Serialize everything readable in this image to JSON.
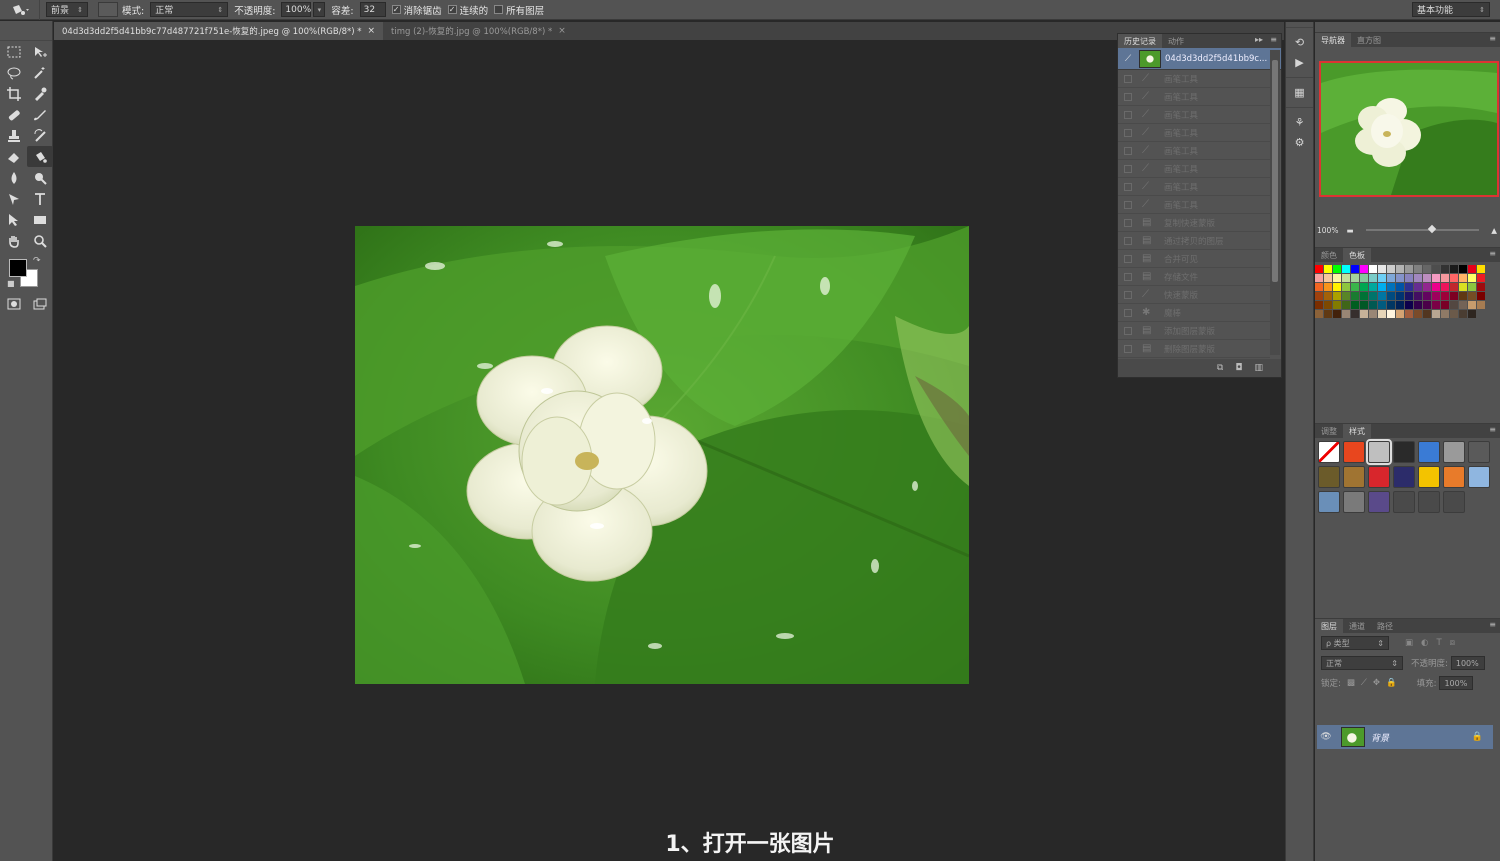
{
  "options_bar": {
    "tool_icon": "paint-bucket-icon",
    "fill_source": "前景",
    "mode_label": "模式:",
    "mode_value": "正常",
    "opacity_label": "不透明度:",
    "opacity_value": "100%",
    "tolerance_label": "容差:",
    "tolerance_value": "32",
    "antialias_label": "消除锯齿",
    "contiguous_label": "连续的",
    "all_layers_label": "所有图层",
    "workspace": "基本功能"
  },
  "tabs": [
    {
      "label": "04d3d3dd2f5d41bb9c77d487721f751e-恢复的.jpeg @ 100%(RGB/8*) *",
      "close": "×"
    },
    {
      "label": "timg (2)-恢复的.jpg @ 100%(RGB/8*) *",
      "close": "×"
    }
  ],
  "history": {
    "tab_history": "历史记录",
    "tab_actions": "动作",
    "snapshot_label": "04d3d3dd2f5d41bb9c...",
    "menu": "▸▸",
    "menu2": "≡"
  },
  "navigator": {
    "tab_navigator": "导航器",
    "tab_histogram": "直方图",
    "zoom": "100%"
  },
  "swatches": {
    "tab_color": "颜色",
    "tab_swatches": "色板",
    "colors": [
      "#ff0000",
      "#ffff00",
      "#00ff00",
      "#00ffff",
      "#0000ff",
      "#ff00ff",
      "#ffffff",
      "#e6e6e6",
      "#cccccc",
      "#b3b3b3",
      "#999999",
      "#808080",
      "#666666",
      "#4d4d4d",
      "#333333",
      "#1a1a1a",
      "#000000",
      "#e6001a",
      "#ffde00",
      "#f5a3a3",
      "#f7c79d",
      "#fdf6a3",
      "#c4df9b",
      "#a3d39c",
      "#82ca9c",
      "#7accc8",
      "#6dcff6",
      "#7ea7d8",
      "#8493ca",
      "#8882be",
      "#a187be",
      "#bc8dbf",
      "#f49ac2",
      "#f6989d",
      "#ff6666",
      "#ffb366",
      "#ffff66",
      "#ed1c24",
      "#f26522",
      "#f7941d",
      "#fff200",
      "#8dc63f",
      "#39b54a",
      "#00a651",
      "#00a99d",
      "#00aeef",
      "#0072bc",
      "#0054a6",
      "#2e3192",
      "#662d91",
      "#92278f",
      "#ec008c",
      "#ed145b",
      "#c1272d",
      "#d9e021",
      "#8cc63f",
      "#9e0b0f",
      "#a0410d",
      "#a36209",
      "#aba000",
      "#598527",
      "#1a7b30",
      "#007236",
      "#00746b",
      "#0076a3",
      "#004b80",
      "#003471",
      "#1b1464",
      "#440e62",
      "#630460",
      "#9e005d",
      "#9e0039",
      "#7d0022",
      "#603813",
      "#754c24",
      "#790000",
      "#7b2e00",
      "#7d4900",
      "#827b00",
      "#406618",
      "#005e20",
      "#005826",
      "#005952",
      "#005b7f",
      "#003663",
      "#002157",
      "#0d004c",
      "#32004b",
      "#4b0049",
      "#7b0046",
      "#7a0026",
      "#534741",
      "#736357",
      "#c69c6d",
      "#a67c52",
      "#8c6239",
      "#603913",
      "#42210b",
      "#998675",
      "#362f2d",
      "#c7b299",
      "#998675",
      "#e6d5b8",
      "#fff5e0",
      "#d4a373",
      "#a35d3d",
      "#7a4b2a",
      "#523620",
      "#b8a692",
      "#8f7a66",
      "#6b5a4a",
      "#4a3d32",
      "#2e2620"
    ]
  },
  "styles": {
    "tab_adjust": "调整",
    "tab_styles": "样式",
    "cells": [
      {
        "fill": "#ffffff",
        "mark": "none"
      },
      {
        "fill": "#e8461e"
      },
      {
        "fill": "#bfbfbf"
      },
      {
        "fill": "#2a2a2a"
      },
      {
        "fill": "#3a7bd5"
      },
      {
        "fill": "#9a9a9a"
      },
      {
        "fill": "#5a5a5a"
      },
      {
        "fill": "#6b5b2a"
      },
      {
        "fill": "#a07432"
      },
      {
        "fill": "#d8262c"
      },
      {
        "fill": "#2c2c6a"
      },
      {
        "fill": "#f3c300"
      },
      {
        "fill": "#e87b2a"
      },
      {
        "fill": "#8fb6e0"
      },
      {
        "fill": "#6a8fb8"
      },
      {
        "fill": "#7a7a7a"
      },
      {
        "fill": "#5a4a8a"
      },
      {
        "fill": "#4a4a4a"
      },
      {
        "fill": "#4a4a4a"
      },
      {
        "fill": "#4a4a4a"
      }
    ]
  },
  "layers": {
    "tab_layers": "图层",
    "tab_channels": "通道",
    "tab_paths": "路径",
    "filter_label": "ρ 类型",
    "blend_mode": "正常",
    "opacity_label": "不透明度:",
    "opacity_value": "100%",
    "lock_label": "锁定:",
    "fill_label": "填充:",
    "fill_value": "100%",
    "background_layer": "背景"
  },
  "caption": "1、打开一张图片",
  "history_items": [
    {
      "icon": "brush-icon",
      "label": "画笔工具"
    },
    {
      "icon": "brush-icon",
      "label": "画笔工具"
    },
    {
      "icon": "brush-icon",
      "label": "画笔工具"
    },
    {
      "icon": "brush-icon",
      "label": "画笔工具"
    },
    {
      "icon": "brush-icon",
      "label": "画笔工具"
    },
    {
      "icon": "brush-icon",
      "label": "画笔工具"
    },
    {
      "icon": "brush-icon",
      "label": "画笔工具"
    },
    {
      "icon": "brush-icon",
      "label": "画笔工具"
    },
    {
      "icon": "document-icon",
      "label": "复制快速蒙版"
    },
    {
      "icon": "document-icon",
      "label": "通过拷贝的图层"
    },
    {
      "icon": "document-icon",
      "label": "合并可见"
    },
    {
      "icon": "document-icon",
      "label": "存储文件"
    },
    {
      "icon": "brush-icon",
      "label": "快速蒙版"
    },
    {
      "icon": "magic-wand-icon",
      "label": "魔棒"
    },
    {
      "icon": "document-icon",
      "label": "添加图层蒙版"
    },
    {
      "icon": "document-icon",
      "label": "删除图层蒙版"
    }
  ]
}
